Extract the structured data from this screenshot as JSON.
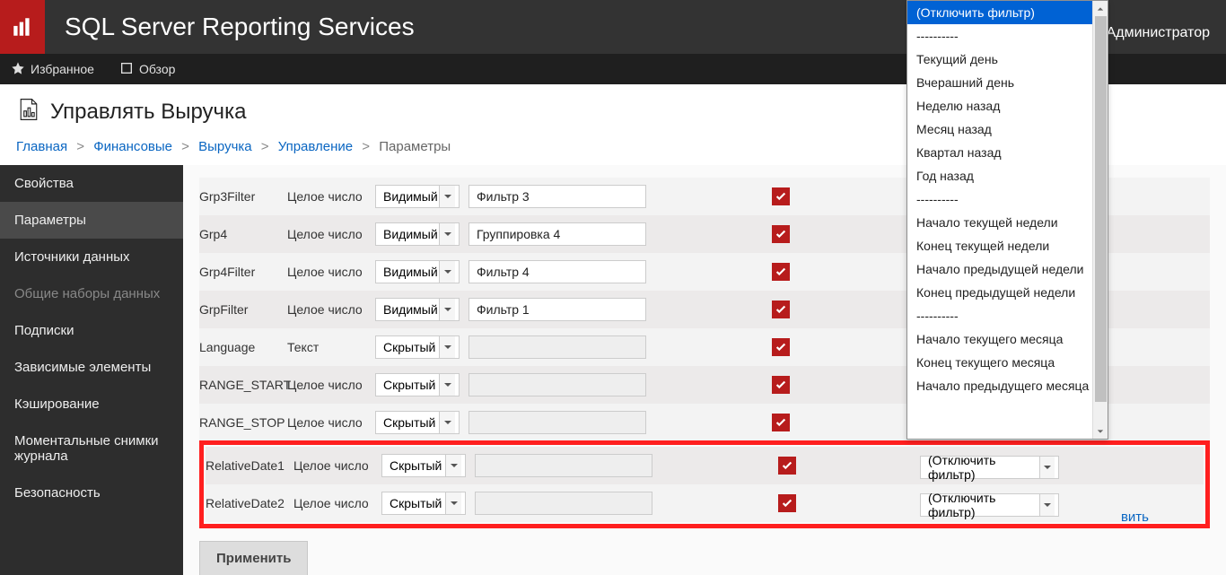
{
  "header": {
    "product": "SQL Server Reporting Services",
    "admin": "Администратор"
  },
  "subnav": {
    "favorites": "Избранное",
    "browse": "Обзор"
  },
  "page": {
    "title": "Управлять Выручка"
  },
  "breadcrumb": {
    "items": [
      "Главная",
      "Финансовые",
      "Выручка",
      "Управление"
    ],
    "current": "Параметры"
  },
  "sidebar": {
    "items": [
      {
        "label": "Свойства",
        "active": false,
        "disabled": false
      },
      {
        "label": "Параметры",
        "active": true,
        "disabled": false
      },
      {
        "label": "Источники данных",
        "active": false,
        "disabled": false
      },
      {
        "label": "Общие наборы данных",
        "active": false,
        "disabled": true
      },
      {
        "label": "Подписки",
        "active": false,
        "disabled": false
      },
      {
        "label": "Зависимые элементы",
        "active": false,
        "disabled": false
      },
      {
        "label": "Кэширование",
        "active": false,
        "disabled": false
      },
      {
        "label": "Моментальные снимки журнала",
        "active": false,
        "disabled": false
      },
      {
        "label": "Безопасность",
        "active": false,
        "disabled": false
      }
    ]
  },
  "params": {
    "rows": [
      {
        "name": "Grp3Filter",
        "type": "Целое число",
        "vis": "Видимый",
        "label": "Фильтр 3",
        "labelDisabled": false,
        "checked": true,
        "default": null
      },
      {
        "name": "Grp4",
        "type": "Целое число",
        "vis": "Видимый",
        "label": "Группировка 4",
        "labelDisabled": false,
        "checked": true,
        "default": null
      },
      {
        "name": "Grp4Filter",
        "type": "Целое число",
        "vis": "Видимый",
        "label": "Фильтр 4",
        "labelDisabled": false,
        "checked": true,
        "default": null
      },
      {
        "name": "GrpFilter",
        "type": "Целое число",
        "vis": "Видимый",
        "label": "Фильтр 1",
        "labelDisabled": false,
        "checked": true,
        "default": null
      },
      {
        "name": "Language",
        "type": "Текст",
        "vis": "Скрытый",
        "label": "",
        "labelDisabled": true,
        "checked": true,
        "default": null
      },
      {
        "name": "RANGE_START",
        "type": "Целое число",
        "vis": "Скрытый",
        "label": "",
        "labelDisabled": true,
        "checked": true,
        "default": null
      },
      {
        "name": "RANGE_STOP",
        "type": "Целое число",
        "vis": "Скрытый",
        "label": "",
        "labelDisabled": true,
        "checked": true,
        "default": null
      },
      {
        "name": "RelativeDate1",
        "type": "Целое число",
        "vis": "Скрытый",
        "label": "",
        "labelDisabled": true,
        "checked": true,
        "default": "(Отключить фильтр)"
      },
      {
        "name": "RelativeDate2",
        "type": "Целое число",
        "vis": "Скрытый",
        "label": "",
        "labelDisabled": true,
        "checked": true,
        "default": "(Отключить фильтр)"
      }
    ],
    "apply": "Применить",
    "restorePartial": "вить"
  },
  "dropdown": {
    "options": [
      "(Отключить фильтр)",
      "----------",
      "Текущий день",
      "Вчерашний день",
      "Неделю назад",
      "Месяц назад",
      "Квартал назад",
      "Год назад",
      "----------",
      "Начало текущей недели",
      "Конец текущей недели",
      "Начало предыдущей недели",
      "Конец предыдущей недели",
      "----------",
      "Начало текущего месяца",
      "Конец текущего месяца",
      "Начало предыдущего месяца"
    ],
    "selectedIndex": 0
  }
}
